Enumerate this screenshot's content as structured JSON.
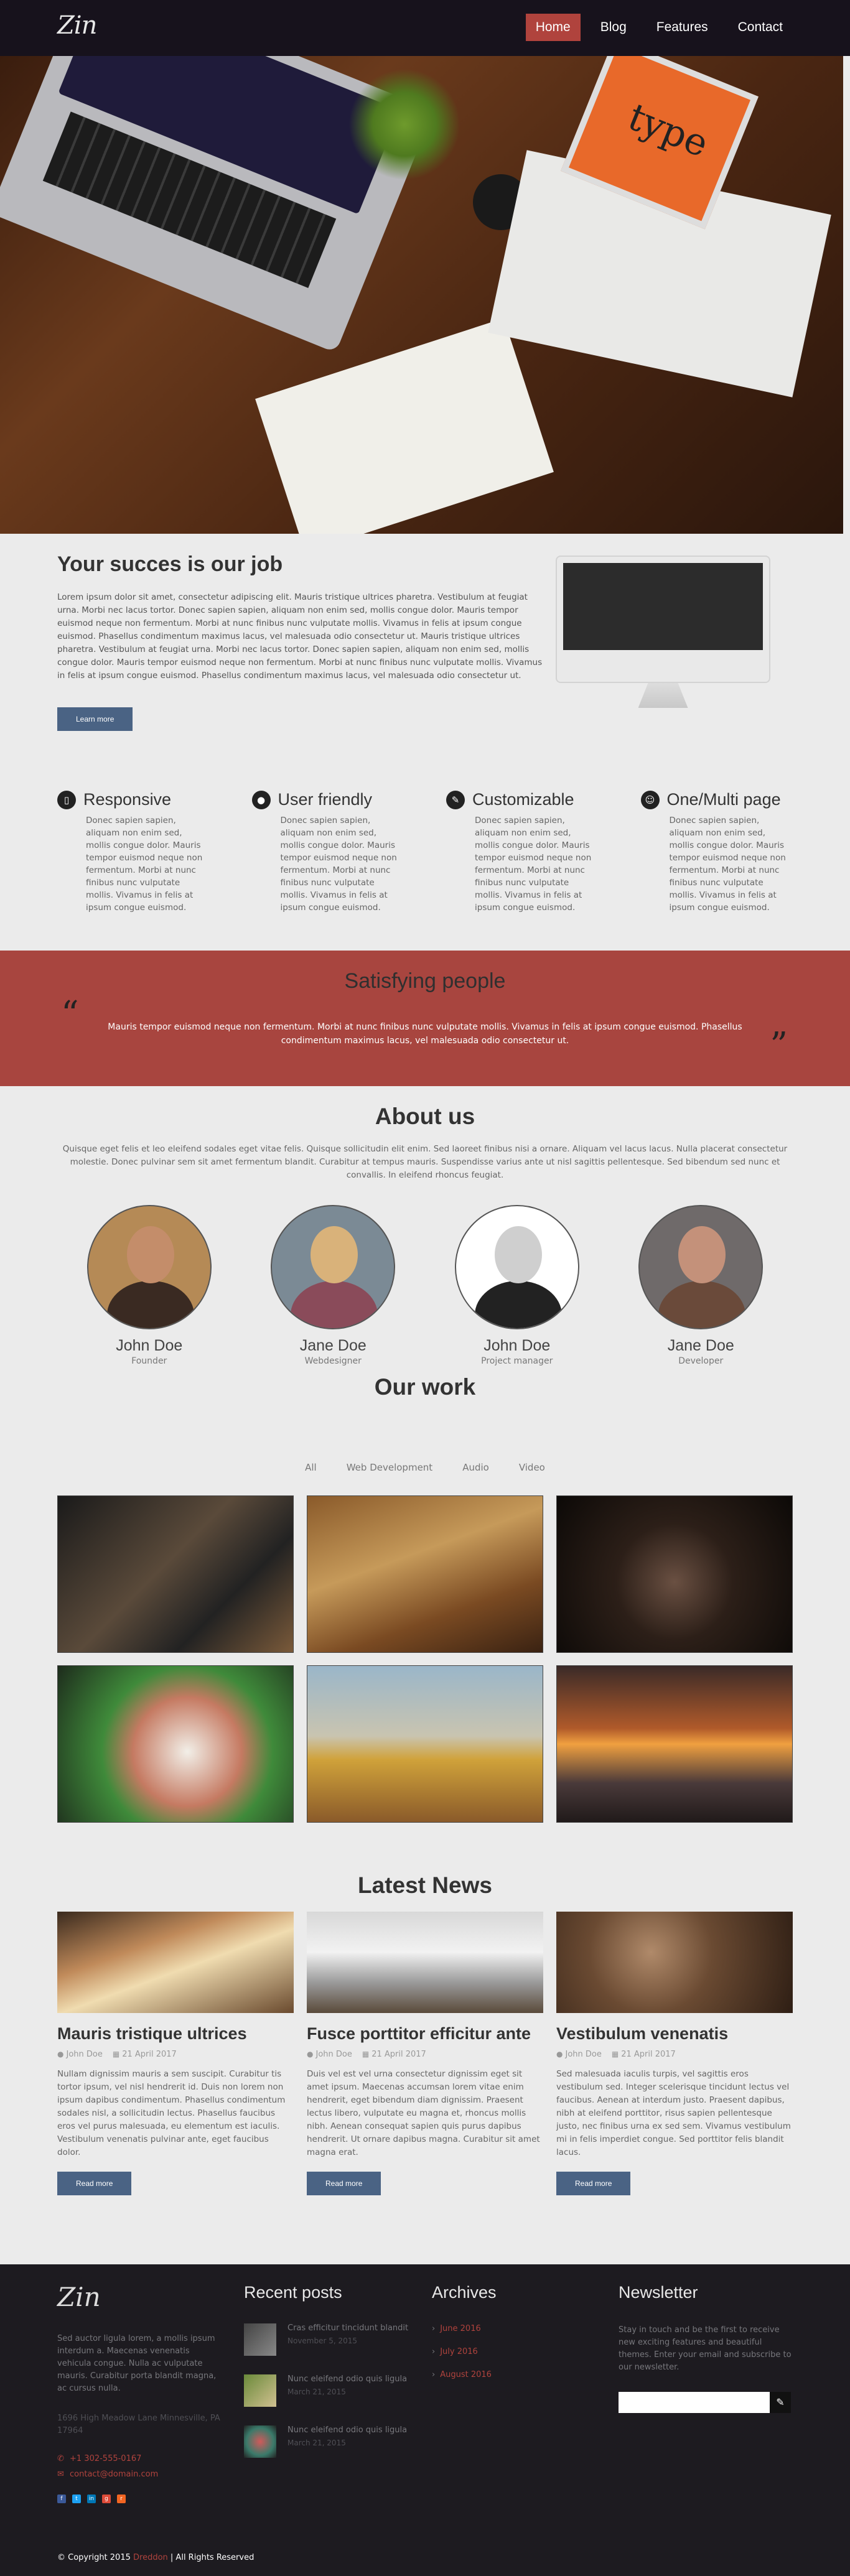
{
  "nav": {
    "logo": "Zin",
    "items": [
      {
        "label": "Home",
        "active": true
      },
      {
        "label": "Blog",
        "active": false
      },
      {
        "label": "Features",
        "active": false
      },
      {
        "label": "Contact",
        "active": false
      }
    ]
  },
  "hero": {
    "book_text": "type"
  },
  "intro": {
    "title": "Your succes is our job",
    "text": "Lorem ipsum dolor sit amet, consectetur adipiscing elit. Mauris tristique ultrices pharetra. Vestibulum at feugiat urna. Morbi nec lacus tortor. Donec sapien sapien, aliquam non enim sed, mollis congue dolor. Mauris tempor euismod neque non fermentum. Morbi at nunc finibus nunc vulputate mollis. Vivamus in felis at ipsum congue euismod. Phasellus condimentum maximus lacus, vel malesuada odio consectetur ut. Mauris tristique ultrices pharetra. Vestibulum at feugiat urna. Morbi nec lacus tortor. Donec sapien sapien, aliquam non enim sed, mollis congue dolor. Mauris tempor euismod neque non fermentum. Morbi at nunc finibus nunc vulputate mollis. Vivamus in felis at ipsum congue euismod. Phasellus condimentum maximus lacus, vel malesuada odio consectetur ut.",
    "button": "Learn more"
  },
  "features": [
    {
      "icon": "mobile-icon",
      "glyph": "▯",
      "title": "Responsive",
      "text": "Donec sapien sapien, aliquam non enim sed, mollis congue dolor. Mauris tempor euismod neque non fermentum. Morbi at nunc finibus nunc vulputate mollis. Vivamus in felis at ipsum congue euismod."
    },
    {
      "icon": "user-icon",
      "glyph": "●",
      "title": "User friendly",
      "text": "Donec sapien sapien, aliquam non enim sed, mollis congue dolor. Mauris tempor euismod neque non fermentum. Morbi at nunc finibus nunc vulputate mollis. Vivamus in felis at ipsum congue euismod."
    },
    {
      "icon": "brush-icon",
      "glyph": "✎",
      "title": "Customizable",
      "text": "Donec sapien sapien, aliquam non enim sed, mollis congue dolor. Mauris tempor euismod neque non fermentum. Morbi at nunc finibus nunc vulputate mollis. Vivamus in felis at ipsum congue euismod."
    },
    {
      "icon": "page-icon",
      "glyph": "☺",
      "title": "One/Multi page",
      "text": "Donec sapien sapien, aliquam non enim sed, mollis congue dolor. Mauris tempor euismod neque non fermentum. Morbi at nunc finibus nunc vulputate mollis. Vivamus in felis at ipsum congue euismod."
    }
  ],
  "testimonial": {
    "title": "Satisfying people",
    "text": "Mauris tempor euismod neque non fermentum. Morbi at nunc finibus nunc vulputate mollis. Vivamus in felis at ipsum congue euismod. Phasellus condimentum maximus lacus, vel malesuada odio consectetur ut.",
    "open_quote": "“",
    "close_quote": "”"
  },
  "about": {
    "title": "About us",
    "text": "Quisque eget felis et leo eleifend sodales eget vitae felis. Quisque sollicitudin elit enim. Sed laoreet finibus nisi a ornare. Aliquam vel lacus lacus. Nulla placerat consectetur molestie. Donec pulvinar sem sit amet fermentum blandit. Curabitur at tempus mauris. Suspendisse varius ante ut nisl sagittis pellentesque. Sed bibendum sed nunc et convallis. In eleifend rhoncus feugiat.",
    "team": [
      {
        "name": "John Doe",
        "role": "Founder",
        "skin": "#c48d6a",
        "cloth": "#3a2a22",
        "bg": "#b58a56"
      },
      {
        "name": "Jane Doe",
        "role": "Webdesigner",
        "skin": "#d9b27a",
        "cloth": "#8a4b5a",
        "bg": "#7b8a95"
      },
      {
        "name": "John Doe",
        "role": "Project manager",
        "skin": "#cfcfcf",
        "cloth": "#222",
        "bg": "#ffffff"
      },
      {
        "name": "Jane Doe",
        "role": "Developer",
        "skin": "#c4917a",
        "cloth": "#6a4a3a",
        "bg": "#6f6a6a"
      }
    ]
  },
  "work": {
    "title": "Our work",
    "filters": [
      "All",
      "Web Development",
      "Audio",
      "Video"
    ],
    "items": [
      {
        "name": "camera-lens-image",
        "bg": "linear-gradient(135deg,#1a1a1a 0%,#5a4a3a 45%,#222 70%,#7a5a3a 100%)"
      },
      {
        "name": "kitchen-image",
        "bg": "linear-gradient(160deg,#8a5a2a 0%,#c69a5a 40%,#7a4a22 70%,#3a2212 100%)"
      },
      {
        "name": "coffee-grinder-image",
        "bg": "radial-gradient(circle at 50% 55%,#6a5042 0%,#2c1f18 40%,#0c0907 100%)"
      },
      {
        "name": "food-plate-image",
        "bg": "radial-gradient(circle at 55% 55%,#f2efe8 0%,#c57a62 35%,#3f8a3a 55%,#1d2b1c 100%)"
      },
      {
        "name": "bulldozer-image",
        "bg": "linear-gradient(180deg,#9ab6c9 0%,#c9c4b0 45%,#d0a23a 60%,#8a5a2a 100%)"
      },
      {
        "name": "sunset-beach-image",
        "bg": "linear-gradient(180deg,#3a2a28 0%,#b05a2a 40%,#f0a040 50%,#4a3a3a 75%,#201a1a 100%)"
      }
    ]
  },
  "news": {
    "title": "Latest News",
    "posts": [
      {
        "title": "Mauris tristique ultrices",
        "author": "John Doe",
        "date": "21 April 2017",
        "text": "Nullam dignissim mauris a sem suscipit. Curabitur tis tortor ipsum, vel nisl hendrerit id. Duis non lorem non ipsum dapibus condimentum. Phasellus condimentum sodales nisl, a sollicitudin lectus. Phasellus faucibus eros vel purus malesuada, eu elementum est iaculis. Vestibulum venenatis pulvinar ante, eget faucibus dolor.",
        "button": "Read more",
        "img": "linear-gradient(160deg,#3a2a1e 0%,#c08a5a 35%,#f0dcb0 55%,#6a4a2e 100%)"
      },
      {
        "title": "Fusce porttitor efficitur ante",
        "author": "John Doe",
        "date": "21 April 2017",
        "text": "Duis vel est vel urna consectetur dignissim eget sit amet ipsum. Maecenas accumsan lorem vitae enim hendrerit, eget bibendum diam dignissim. Praesent lectus libero, vulputate eu magna et, rhoncus mollis nibh. Aenean consequat sapien quis purus dapibus hendrerit. Ut ornare dapibus magna. Curabitur sit amet magna erat.",
        "button": "Read more",
        "img": "linear-gradient(180deg,#d8d8d8 0%,#f2f2f2 40%,#9a9a9a 70%,#5a4a3a 100%)"
      },
      {
        "title": "Vestibulum venenatis",
        "author": "John Doe",
        "date": "21 April 2017",
        "text": "Sed malesuada iaculis turpis, vel sagittis eros vestibulum sed. Integer scelerisque tincidunt lectus vel faucibus. Aenean at interdum justo. Praesent dapibus, nibh at eleifend porttitor, risus sapien pellentesque justo, nec finibus urna ex sed sem. Vivamus vestibulum mi in felis imperdiet congue. Sed porttitor felis blandit lacus.",
        "button": "Read more",
        "img": "radial-gradient(circle at 40% 40%,#b08a6a 0%,#6a4a32 40%,#2e1e14 100%)"
      }
    ]
  },
  "footer": {
    "logo": "Zin",
    "about": "Sed auctor ligula lorem, a mollis ipsum interdum a. Maecenas venenatis vehicula congue. Nulla ac vulputate mauris. Curabitur porta blandit magna, ac cursus nulla.",
    "address": "1696 High Meadow Lane Minnesville, PA 17964",
    "phone": "+1 302-555-0167",
    "email": "contact@domain.com",
    "socials": [
      {
        "name": "facebook-icon",
        "glyph": "f",
        "color": "#3b5998"
      },
      {
        "name": "twitter-icon",
        "glyph": "t",
        "color": "#1da1f2"
      },
      {
        "name": "linkedin-icon",
        "glyph": "in",
        "color": "#0077b5"
      },
      {
        "name": "google-plus-icon",
        "glyph": "g",
        "color": "#dd4b39"
      },
      {
        "name": "rss-icon",
        "glyph": "r",
        "color": "#f26522"
      }
    ],
    "recent_title": "Recent posts",
    "recent_posts": [
      {
        "title": "Cras efficitur tincidunt blandit",
        "date": "November 5, 2015",
        "thumb": "linear-gradient(135deg,#444,#888)"
      },
      {
        "title": "Nunc eleifend odio quis ligula",
        "date": "March 21, 2015",
        "thumb": "linear-gradient(135deg,#6a8a3a,#d0c090)"
      },
      {
        "title": "Nunc eleifend odio quis ligula",
        "date": "March 21, 2015",
        "thumb": "radial-gradient(circle,#d05a5a,#3a7a6a 60%,#222)"
      }
    ],
    "archives_title": "Archives",
    "archives": [
      "June 2016",
      "July 2016",
      "August 2016"
    ],
    "newsletter_title": "Newsletter",
    "newsletter_text": "Stay in touch and be the first to receive new exciting features and beautiful themes. Enter your email and subscribe to our newsletter.",
    "newsletter_placeholder": "",
    "copyright_prefix": "© Copyright 2015",
    "copyright_brand": "Dreddon",
    "copyright_suffix": "| All Rights Reserved"
  }
}
